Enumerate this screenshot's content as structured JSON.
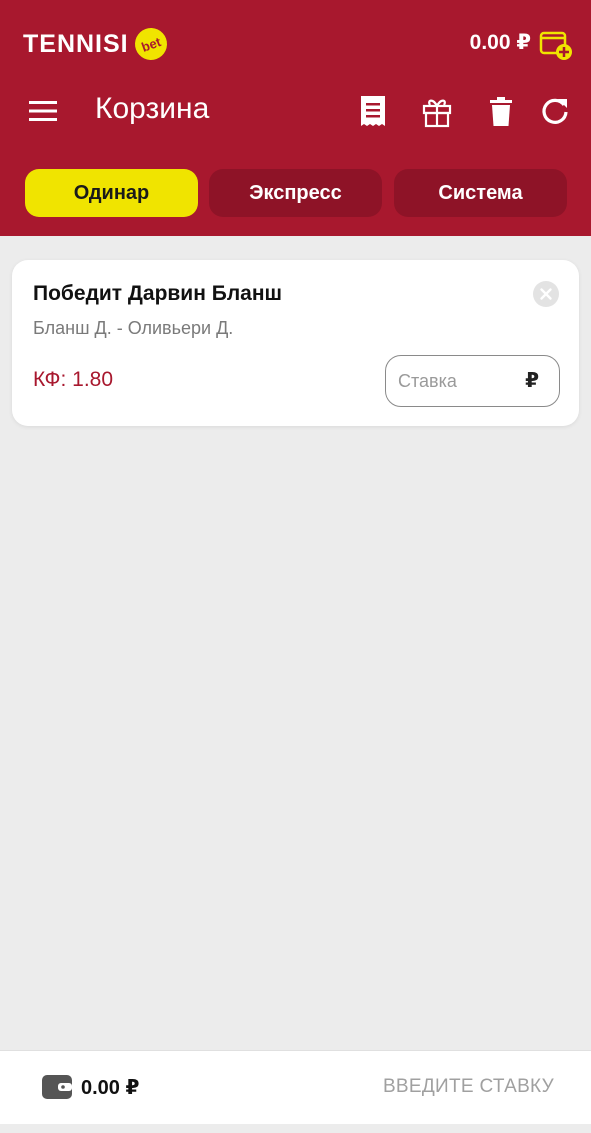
{
  "brand": {
    "name": "TENNISI",
    "badge": "bet",
    "accent": "#a8182e",
    "highlight": "#f0e400"
  },
  "header": {
    "balance": "0.00 ₽",
    "wallet_icon": "wallet-add-icon"
  },
  "toolbar": {
    "title": "Корзина",
    "icons": [
      "menu-icon",
      "receipt-icon",
      "gift-icon",
      "trash-icon",
      "refresh-icon"
    ]
  },
  "tabs": [
    {
      "label": "Одинар",
      "active": true
    },
    {
      "label": "Экспресс",
      "active": false
    },
    {
      "label": "Система",
      "active": false
    }
  ],
  "bet": {
    "title": "Победит Дарвин Бланш",
    "match": "Бланш Д. - Оливьери Д.",
    "coef": "КФ: 1.80",
    "stake_placeholder": "Ставка",
    "stake_value": "",
    "currency": "₽"
  },
  "footer": {
    "balance": "0.00 ₽",
    "action": "ВВЕДИТЕ СТАВКУ"
  }
}
